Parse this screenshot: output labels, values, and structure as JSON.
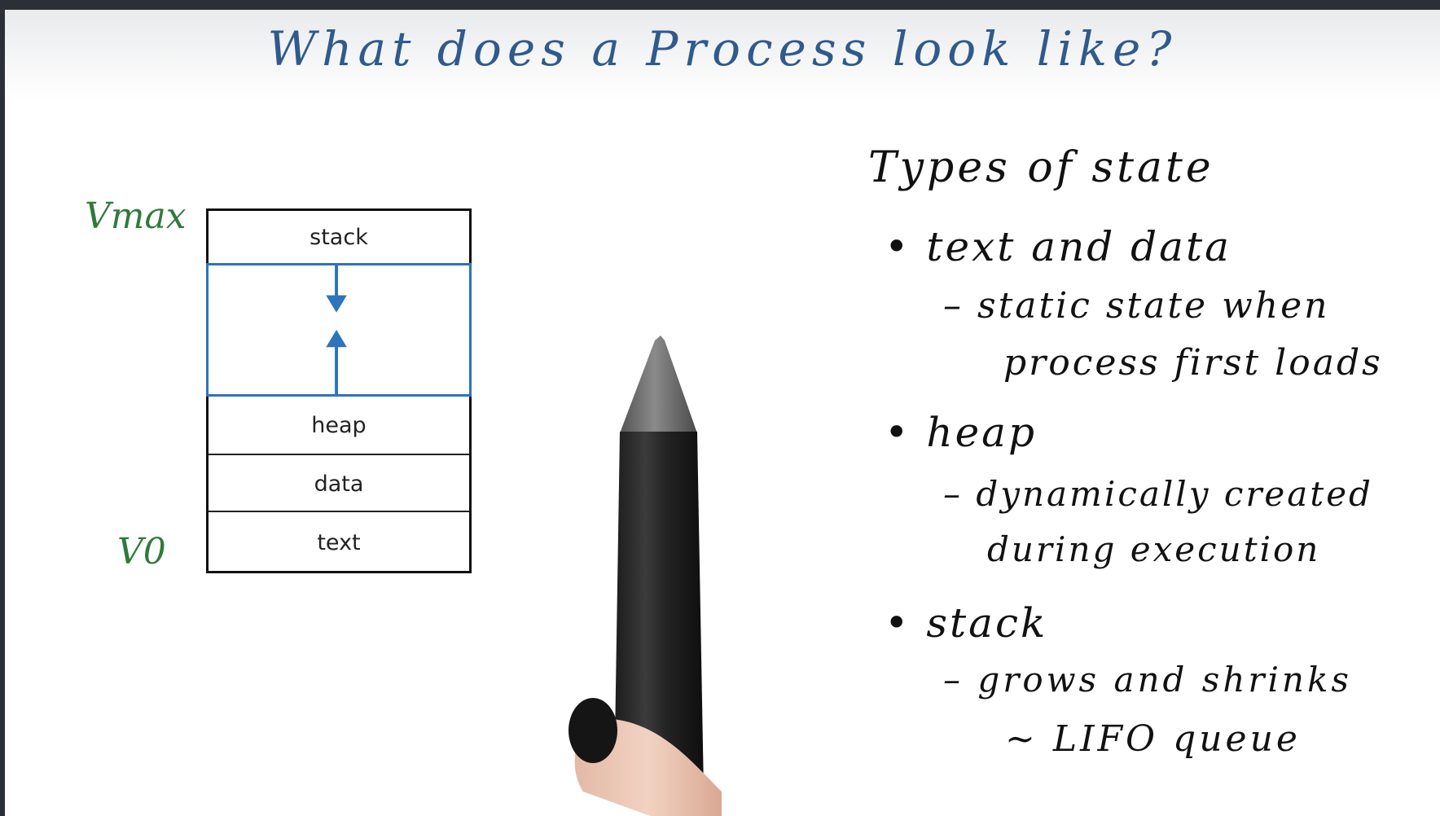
{
  "title": "What does a Process look like?",
  "diagram": {
    "top_label": "Vmax",
    "bottom_label": "V0",
    "segments": {
      "stack": "stack",
      "heap": "heap",
      "data": "data",
      "text": "text"
    },
    "arrow_color": "#2d73bd"
  },
  "notes": {
    "heading": "Types of state",
    "text_data": "• text and data",
    "text_data_sub_1": "– static state when",
    "text_data_sub_2": "process first loads",
    "heap": "• heap",
    "heap_sub_1": "– dynamically created",
    "heap_sub_2": "during execution",
    "stack": "• stack",
    "stack_sub_1": "– grows and shrinks",
    "stack_sub_2": "~ LIFO queue"
  },
  "colors": {
    "title": "#2f5b8c",
    "labels": "#2f7a3a",
    "free_region_border": "#2d73bd"
  }
}
